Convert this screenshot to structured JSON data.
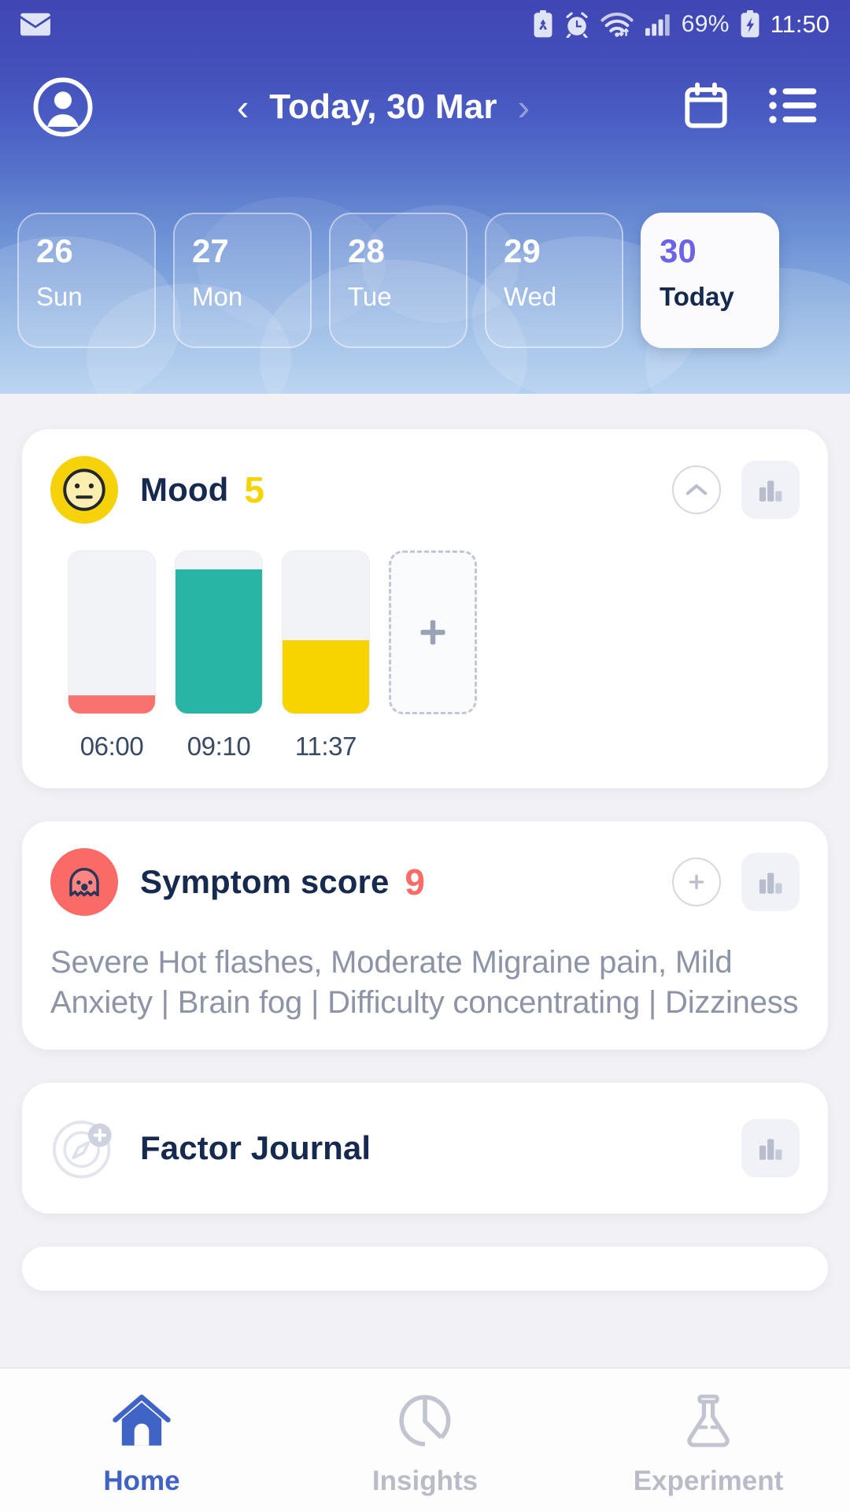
{
  "statusbar": {
    "mail_icon": "mail-icon",
    "icons": [
      "battery-saver-icon",
      "alarm-icon",
      "wifi-icon",
      "signal-icon"
    ],
    "battery_percent": "69%",
    "battery_icon": "battery-charging-icon",
    "clock": "11:50"
  },
  "appbar": {
    "avatar_icon": "profile-avatar-icon",
    "prev_icon": "chevron-left-icon",
    "next_icon": "chevron-right-icon",
    "title": "Today, 30 Mar",
    "calendar_icon": "calendar-icon",
    "menu_icon": "list-menu-icon"
  },
  "datestrip": {
    "days": [
      {
        "num": "",
        "label": "",
        "today": false,
        "partial": true
      },
      {
        "num": "26",
        "label": "Sun",
        "today": false,
        "partial": false
      },
      {
        "num": "27",
        "label": "Mon",
        "today": false,
        "partial": false
      },
      {
        "num": "28",
        "label": "Tue",
        "today": false,
        "partial": false
      },
      {
        "num": "29",
        "label": "Wed",
        "today": false,
        "partial": false
      },
      {
        "num": "30",
        "label": "Today",
        "today": true,
        "partial": false
      }
    ]
  },
  "cards": {
    "mood": {
      "icon": "neutral-face-emoji-icon",
      "title": "Mood",
      "score": "5",
      "collapse_icon": "chevron-up-icon",
      "chart_icon": "bar-chart-icon",
      "add_icon": "plus-icon",
      "entries": [
        {
          "time": "06:00",
          "fill_pct": 11,
          "color": "#f8736f"
        },
        {
          "time": "09:10",
          "fill_pct": 89,
          "color": "#28b5a5"
        },
        {
          "time": "11:37",
          "fill_pct": 45,
          "color": "#f7d400"
        }
      ]
    },
    "symptom": {
      "icon": "ghost-symptom-icon",
      "title": "Symptom score",
      "score": "9",
      "add_icon": "plus-circle-icon",
      "chart_icon": "bar-chart-icon",
      "description": "Severe Hot flashes, Moderate Migraine pain, Mild Anxiety | Brain fog | Difficulty concentrating | Dizziness"
    },
    "factor": {
      "icon": "compass-add-icon",
      "title": "Factor Journal",
      "chart_icon": "bar-chart-icon"
    }
  },
  "bottomnav": {
    "items": [
      {
        "label": "Home",
        "icon": "home-icon",
        "active": true
      },
      {
        "label": "Insights",
        "icon": "pie-chart-icon",
        "active": false
      },
      {
        "label": "Experiment",
        "icon": "flask-icon",
        "active": false
      }
    ]
  },
  "colors": {
    "header_blue": "#4046b4",
    "accent_purple": "#6c63e6",
    "mood_yellow": "#f5d209",
    "symptom_coral": "#fa6a66",
    "teal": "#28b5a5",
    "nav_active": "#3f62c4",
    "navy_text": "#16294f"
  }
}
